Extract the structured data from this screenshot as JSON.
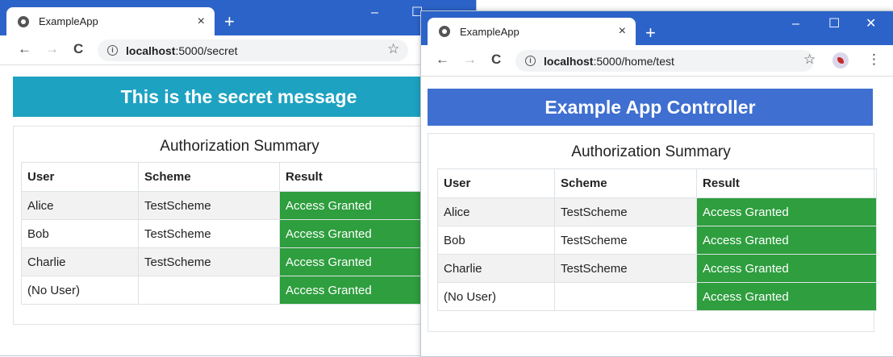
{
  "colors": {
    "chrome": "#2c63c8",
    "banner_secret": "#1ea2c1",
    "banner_controller": "#3f6fd0",
    "granted": "#2e9e3e"
  },
  "icons": {
    "back": "←",
    "forward": "→",
    "reload": "C",
    "info": "i",
    "star": "☆",
    "close": "×",
    "new_tab": "+",
    "minimize": "–",
    "maximize": "☐",
    "window_close": "✕",
    "menu": "⋮"
  },
  "windows": [
    {
      "tab_title": "ExampleApp",
      "url_host": "localhost",
      "url_rest": ":5000/secret",
      "banner": "This is the secret message",
      "summary": {
        "title": "Authorization Summary",
        "columns": [
          "User",
          "Scheme",
          "Result"
        ],
        "rows": [
          {
            "user": "Alice",
            "scheme": "TestScheme",
            "result": "Access Granted"
          },
          {
            "user": "Bob",
            "scheme": "TestScheme",
            "result": "Access Granted"
          },
          {
            "user": "Charlie",
            "scheme": "TestScheme",
            "result": "Access Granted"
          },
          {
            "user": "(No User)",
            "scheme": "",
            "result": "Access Granted"
          }
        ]
      }
    },
    {
      "tab_title": "ExampleApp",
      "url_host": "localhost",
      "url_rest": ":5000/home/test",
      "banner": "Example App Controller",
      "summary": {
        "title": "Authorization Summary",
        "columns": [
          "User",
          "Scheme",
          "Result"
        ],
        "rows": [
          {
            "user": "Alice",
            "scheme": "TestScheme",
            "result": "Access Granted"
          },
          {
            "user": "Bob",
            "scheme": "TestScheme",
            "result": "Access Granted"
          },
          {
            "user": "Charlie",
            "scheme": "TestScheme",
            "result": "Access Granted"
          },
          {
            "user": "(No User)",
            "scheme": "",
            "result": "Access Granted"
          }
        ]
      }
    }
  ]
}
